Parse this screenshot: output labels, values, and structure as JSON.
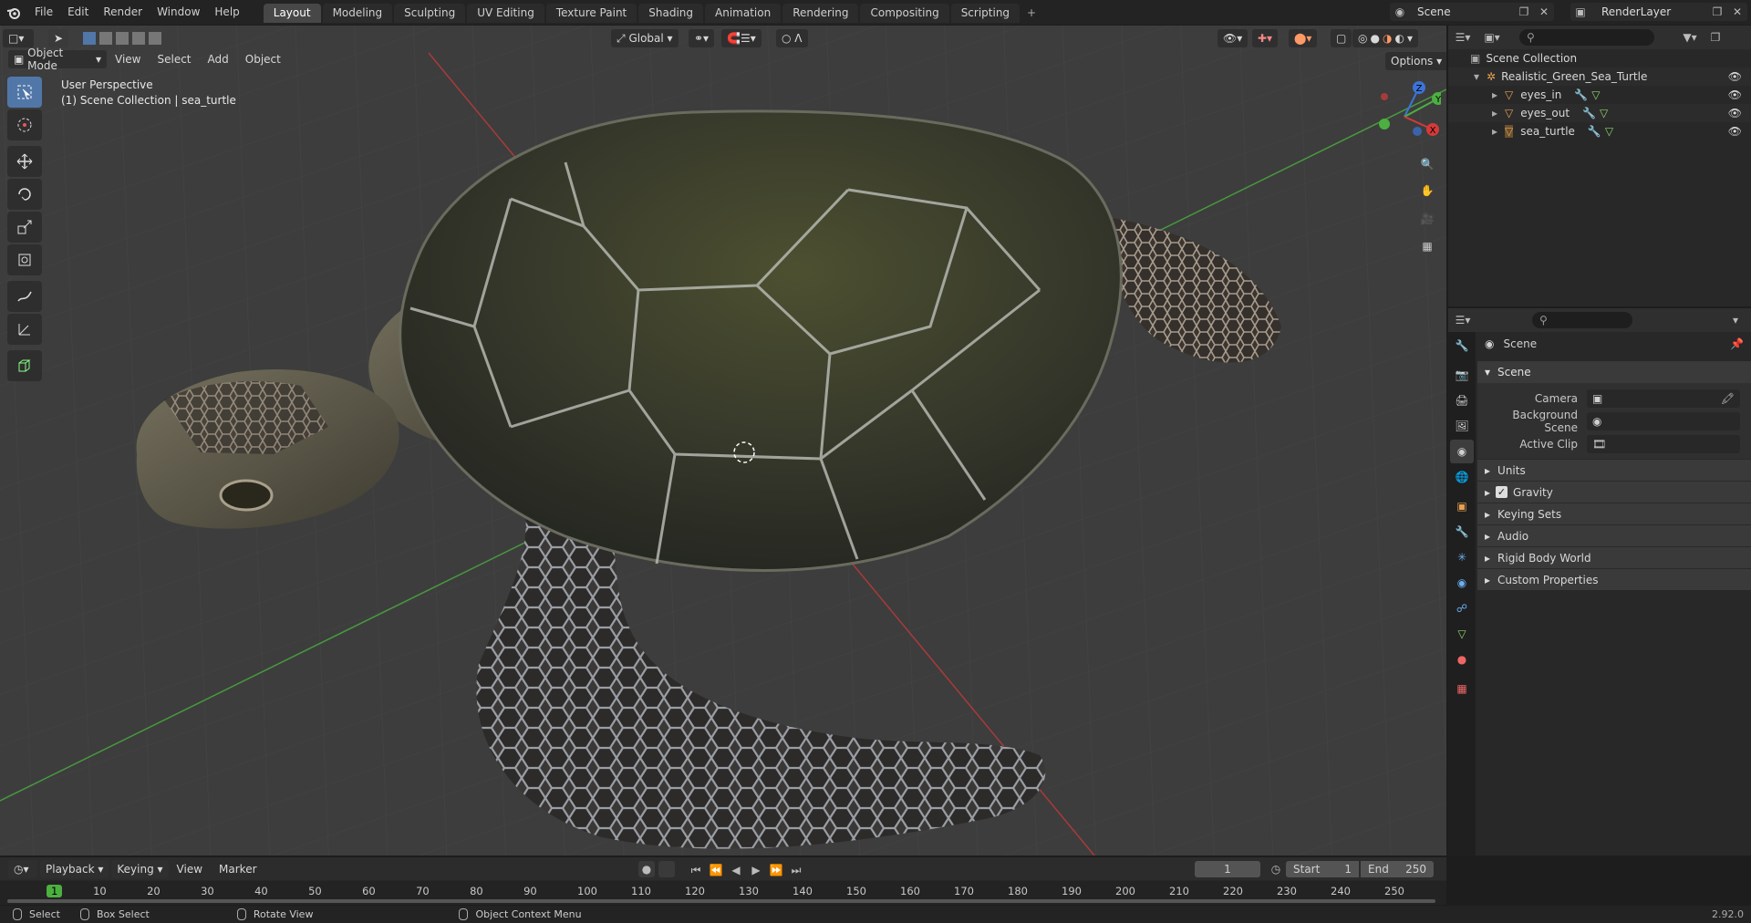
{
  "menu": {
    "file": "File",
    "edit": "Edit",
    "render": "Render",
    "window": "Window",
    "help": "Help"
  },
  "workspaces": [
    "Layout",
    "Modeling",
    "Sculpting",
    "UV Editing",
    "Texture Paint",
    "Shading",
    "Animation",
    "Rendering",
    "Compositing",
    "Scripting"
  ],
  "scene_name": "Scene",
  "view_layer": "RenderLayer",
  "viewport": {
    "mode": "Object Mode",
    "view": "View",
    "select": "Select",
    "add": "Add",
    "object": "Object",
    "orientation": "Global",
    "options": "Options",
    "perspective": "User Perspective",
    "collection_info": "(1) Scene Collection | sea_turtle"
  },
  "gizmo": {
    "x": "X",
    "y": "Y",
    "z": "Z"
  },
  "outliner": {
    "root": "Scene Collection",
    "collection": "Realistic_Green_Sea_Turtle",
    "objects": [
      "eyes_in",
      "eyes_out",
      "sea_turtle"
    ]
  },
  "properties": {
    "header": "Scene",
    "panel": "Scene",
    "camera_label": "Camera",
    "background_label": "Background Scene",
    "clip_label": "Active Clip",
    "subpanels": [
      "Units",
      "Gravity",
      "Keying Sets",
      "Audio",
      "Rigid Body World",
      "Custom Properties"
    ]
  },
  "timeline": {
    "playback": "Playback",
    "keying": "Keying",
    "view": "View",
    "marker": "Marker",
    "current_frame": "1",
    "start_label": "Start",
    "start": "1",
    "end_label": "End",
    "end": "250",
    "ticks": [
      "1",
      "10",
      "20",
      "30",
      "40",
      "50",
      "60",
      "70",
      "80",
      "90",
      "100",
      "110",
      "120",
      "130",
      "140",
      "150",
      "160",
      "170",
      "180",
      "190",
      "200",
      "210",
      "220",
      "230",
      "240",
      "250"
    ]
  },
  "status": {
    "select": "Select",
    "box_select": "Box Select",
    "rotate_view": "Rotate View",
    "context_menu": "Object Context Menu",
    "version": "2.92.0"
  },
  "colors": {
    "accent": "#5177a8",
    "viewport_bg": "#3d3d3d",
    "x_axis": "#d43a3a",
    "y_axis": "#4bb040",
    "z_axis": "#3b74d8"
  }
}
